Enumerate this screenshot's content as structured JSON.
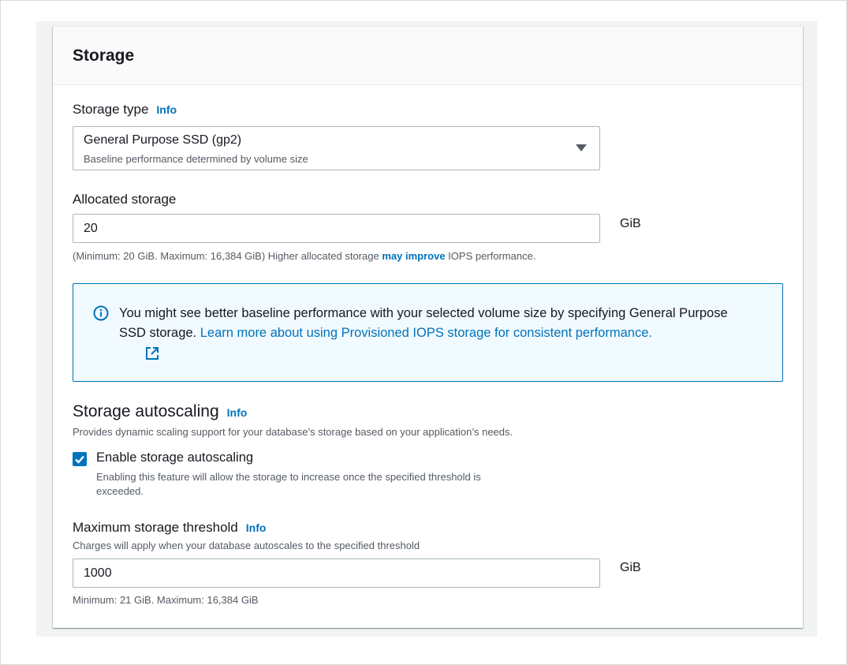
{
  "storage": {
    "title": "Storage",
    "storage_type": {
      "label": "Storage type",
      "info": "Info",
      "selected": "General Purpose SSD (gp2)",
      "selected_desc": "Baseline performance determined by volume size"
    },
    "allocated": {
      "label": "Allocated storage",
      "value": "20",
      "unit": "GiB",
      "hint_prefix": "(Minimum: 20 GiB. Maximum: 16,384 GiB) Higher allocated storage",
      "hint_link": "may improve",
      "hint_suffix": "IOPS performance."
    },
    "alert": {
      "text": "You might see better baseline performance with your selected volume size by specifying General Purpose SSD storage.",
      "link": "Learn more about using Provisioned IOPS storage for consistent performance."
    },
    "autoscaling": {
      "title": "Storage autoscaling",
      "info": "Info",
      "desc": "Provides dynamic scaling support for your database’s storage based on your application’s needs.",
      "checkbox_label": "Enable storage autoscaling",
      "checkbox_checked": true,
      "checkbox_desc_line1": "Enabling this feature will allow the storage to increase once the specified threshold is",
      "checkbox_desc_line2": "exceeded.",
      "threshold_label": "Maximum storage threshold",
      "threshold_info": "Info",
      "threshold_desc": "Charges will apply when your database autoscales to the specified threshold",
      "threshold_value": "1000",
      "threshold_unit": "GiB",
      "threshold_hint": "Minimum: 21 GiB. Maximum: 16,384 GiB"
    }
  },
  "icons": {
    "alert": "info-circle-icon",
    "external": "external-link-icon",
    "caret": "caret-down-icon",
    "check": "checkmark-icon"
  },
  "colors": {
    "link": "#0073bb",
    "alert_bg": "#f1faff",
    "header_bg": "#fafafa"
  }
}
